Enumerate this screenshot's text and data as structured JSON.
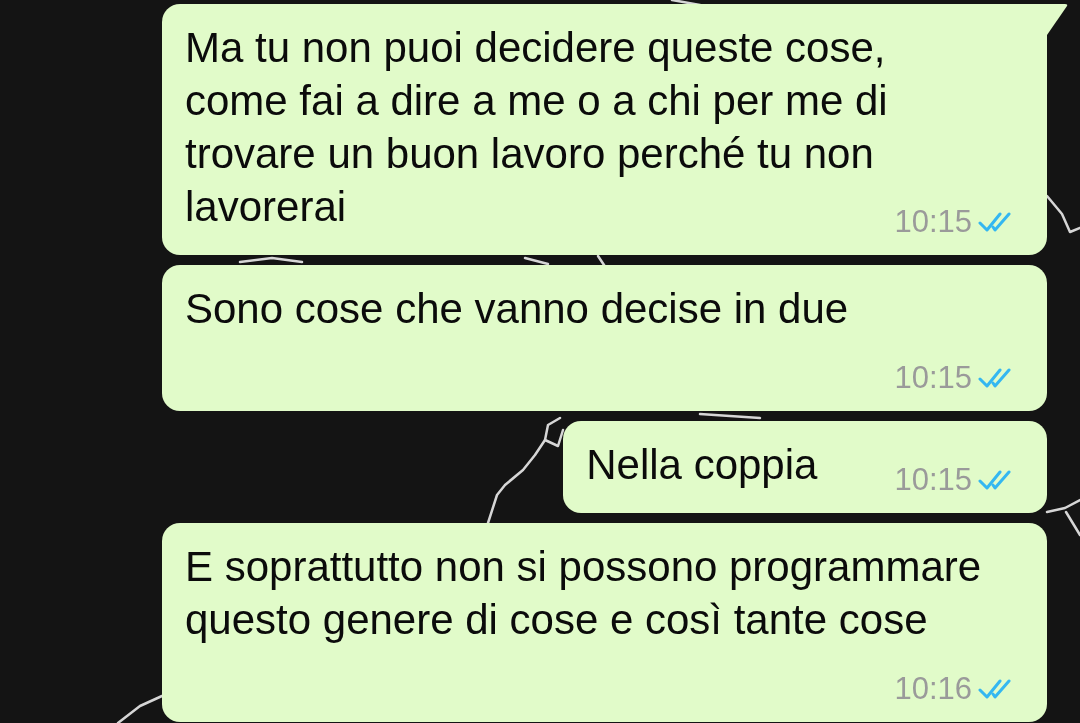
{
  "messages": [
    {
      "kind": "inline",
      "text": "Ma tu non puoi decidere queste cose, come fai a dire a me o a chi per me di trovare un buon lavoro perché tu non lavorerai",
      "time": "10:15",
      "read": true,
      "tail": true
    },
    {
      "kind": "stacked",
      "text": "Sono cose che vanno decise in due",
      "time": "10:15",
      "read": true,
      "tail": false
    },
    {
      "kind": "inline",
      "text": "Nella coppia",
      "time": "10:15",
      "read": true,
      "tail": false
    },
    {
      "kind": "stacked",
      "text": "E soprattutto non si possono programmare questo genere di cose e così tante cose",
      "time": "10:16",
      "read": true,
      "tail": false
    }
  ]
}
